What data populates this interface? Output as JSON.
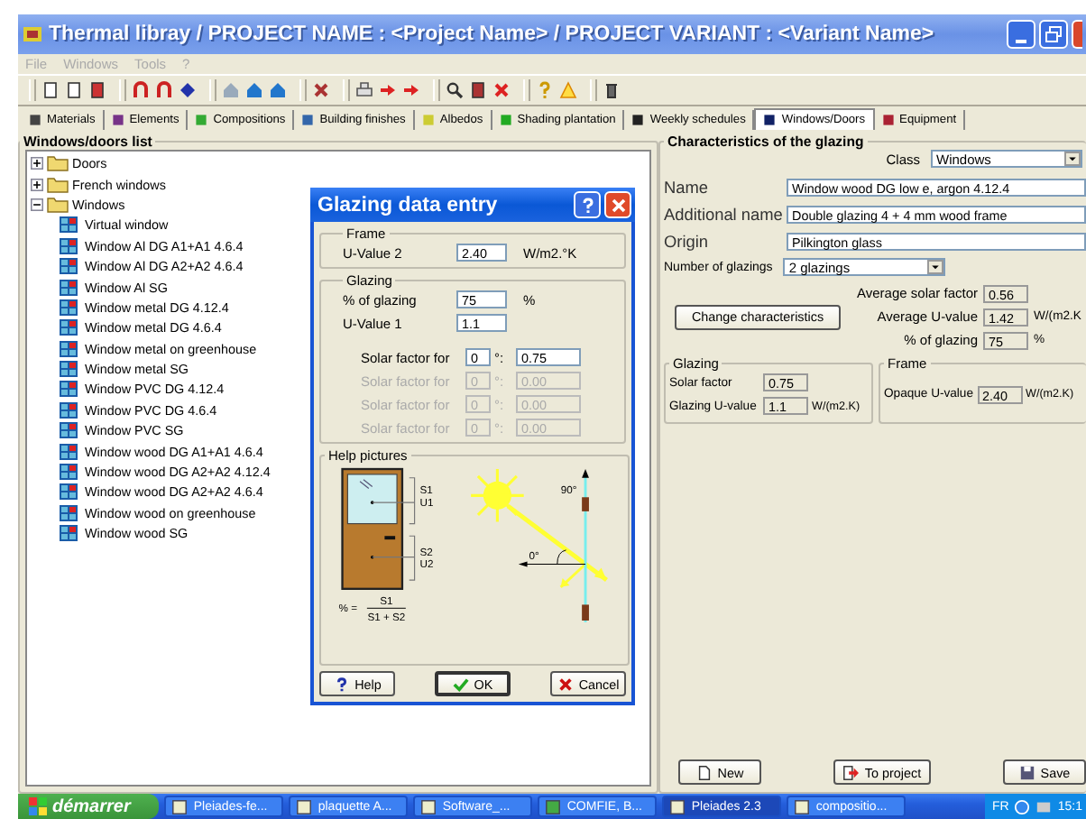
{
  "window": {
    "title": "Thermal libray  /  PROJECT NAME : <Project Name>  /  PROJECT VARIANT : <Variant Name>"
  },
  "menu": [
    {
      "label": "File",
      "disabled": true
    },
    {
      "label": "Windows",
      "disabled": true
    },
    {
      "label": "Tools",
      "disabled": true
    },
    {
      "label": "?",
      "disabled": true
    }
  ],
  "tabs": [
    {
      "label": "Materials",
      "selected": false
    },
    {
      "label": "Elements",
      "selected": false
    },
    {
      "label": "Compositions",
      "selected": false
    },
    {
      "label": "Building finishes",
      "selected": false
    },
    {
      "label": "Albedos",
      "selected": false
    },
    {
      "label": "Shading plantation",
      "selected": false
    },
    {
      "label": "Weekly schedules",
      "selected": false
    },
    {
      "label": "Windows/Doors",
      "selected": true
    },
    {
      "label": "Equipment",
      "selected": false
    }
  ],
  "tree": {
    "title": "Windows/doors list",
    "items": [
      {
        "label": "Doors",
        "expanded": false
      },
      {
        "label": "French windows",
        "expanded": false
      },
      {
        "label": "Windows",
        "expanded": true,
        "children": [
          {
            "label": "Virtual window"
          },
          {
            "label": "Window Al DG A1+A1 4.6.4"
          },
          {
            "label": "Window Al DG A2+A2 4.6.4"
          },
          {
            "label": "Window Al SG"
          },
          {
            "label": "Window metal DG 4.12.4"
          },
          {
            "label": "Window metal DG 4.6.4"
          },
          {
            "label": "Window metal on greenhouse"
          },
          {
            "label": "Window metal SG"
          },
          {
            "label": "Window PVC DG 4.12.4"
          },
          {
            "label": "Window PVC DG 4.6.4"
          },
          {
            "label": "Window PVC SG"
          },
          {
            "label": "Window wood DG A1+A1 4.6.4"
          },
          {
            "label": "Window wood DG A2+A2 4.12.4"
          },
          {
            "label": "Window wood DG A2+A2 4.6.4"
          },
          {
            "label": "Window wood on greenhouse"
          },
          {
            "label": "Window wood SG"
          }
        ]
      }
    ]
  },
  "glazing": {
    "title": "Characteristics of the glazing",
    "class_label": "Class",
    "class_value": "Windows",
    "fields": [
      {
        "label": "Name",
        "value": "Window wood DG low e, argon 4.12.4"
      },
      {
        "label": "Additional name",
        "value": "Double glazing 4 + 4 mm wood frame"
      },
      {
        "label": "Origin",
        "value": "Pilkington glass"
      }
    ],
    "glazings_label": "Number of glazings",
    "glazings_value": "2 glazings",
    "change_button": "Change characteristics",
    "averages": [
      {
        "label": "Average solar factor",
        "value": "0.56"
      },
      {
        "label": "Average U-value",
        "value": "1.42",
        "unit": "W/(m2.K"
      },
      {
        "label": "% of glazing",
        "value": "75",
        "unit": "%"
      }
    ],
    "glazing_group": {
      "title": "Glazing",
      "rows": [
        {
          "label": "Solar factor",
          "value": "0.75"
        },
        {
          "label": "Glazing U-value",
          "value": "1.1",
          "unit": "W/(m2.K)"
        }
      ]
    },
    "frame_group": {
      "title": "Frame",
      "rows": [
        {
          "label": "Opaque U-value",
          "value": "2.40",
          "unit": "W/(m2.K)"
        }
      ]
    },
    "buttons": [
      {
        "label": "New",
        "kind": "new"
      },
      {
        "label": "To project",
        "kind": "project"
      },
      {
        "label": "Save",
        "kind": "save"
      }
    ]
  },
  "dialog": {
    "title": "Glazing data entry",
    "frame": {
      "title": "Frame",
      "label": "U-Value 2",
      "value": "2.40",
      "unit": "W/m2.°K"
    },
    "glazing": {
      "title": "Glazing",
      "rows": [
        {
          "label": "% of glazing",
          "value": "75",
          "unit": "%"
        },
        {
          "label": "U-Value 1",
          "value": "1.1"
        }
      ],
      "solar": [
        {
          "label": "Solar factor for",
          "angle": "0",
          "sep": "°:",
          "value": "0.75",
          "disabled": false
        },
        {
          "label": "Solar factor for",
          "angle": "0",
          "sep": "°:",
          "value": "0.00",
          "disabled": true
        },
        {
          "label": "Solar factor for",
          "angle": "0",
          "sep": "°:",
          "value": "0.00",
          "disabled": true
        },
        {
          "label": "Solar factor for",
          "angle": "0",
          "sep": "°:",
          "value": "0.00",
          "disabled": true
        }
      ]
    },
    "help": {
      "title": "Help pictures",
      "s1": "S1",
      "u1": "U1",
      "s2": "S2",
      "u2": "U2",
      "formula": "% =",
      "numerator": "S1",
      "denominator": "S1 + S2",
      "angle_top": "90°",
      "angle_zero": "0°"
    },
    "buttons": [
      {
        "label": "Help",
        "kind": "help"
      },
      {
        "label": "OK",
        "kind": "ok"
      },
      {
        "label": "Cancel",
        "kind": "cancel"
      }
    ]
  },
  "taskbar": {
    "start": "démarrer",
    "items": [
      {
        "label": "Pleiades-fe...",
        "selected": false
      },
      {
        "label": "plaquette A...",
        "selected": false
      },
      {
        "label": "Software_...",
        "selected": false
      },
      {
        "label": "COMFIE, B...",
        "selected": false
      },
      {
        "label": "Pleiades 2.3",
        "selected": true
      },
      {
        "label": "compositio...",
        "selected": false
      }
    ],
    "lang": "FR",
    "clock": "15:1"
  }
}
